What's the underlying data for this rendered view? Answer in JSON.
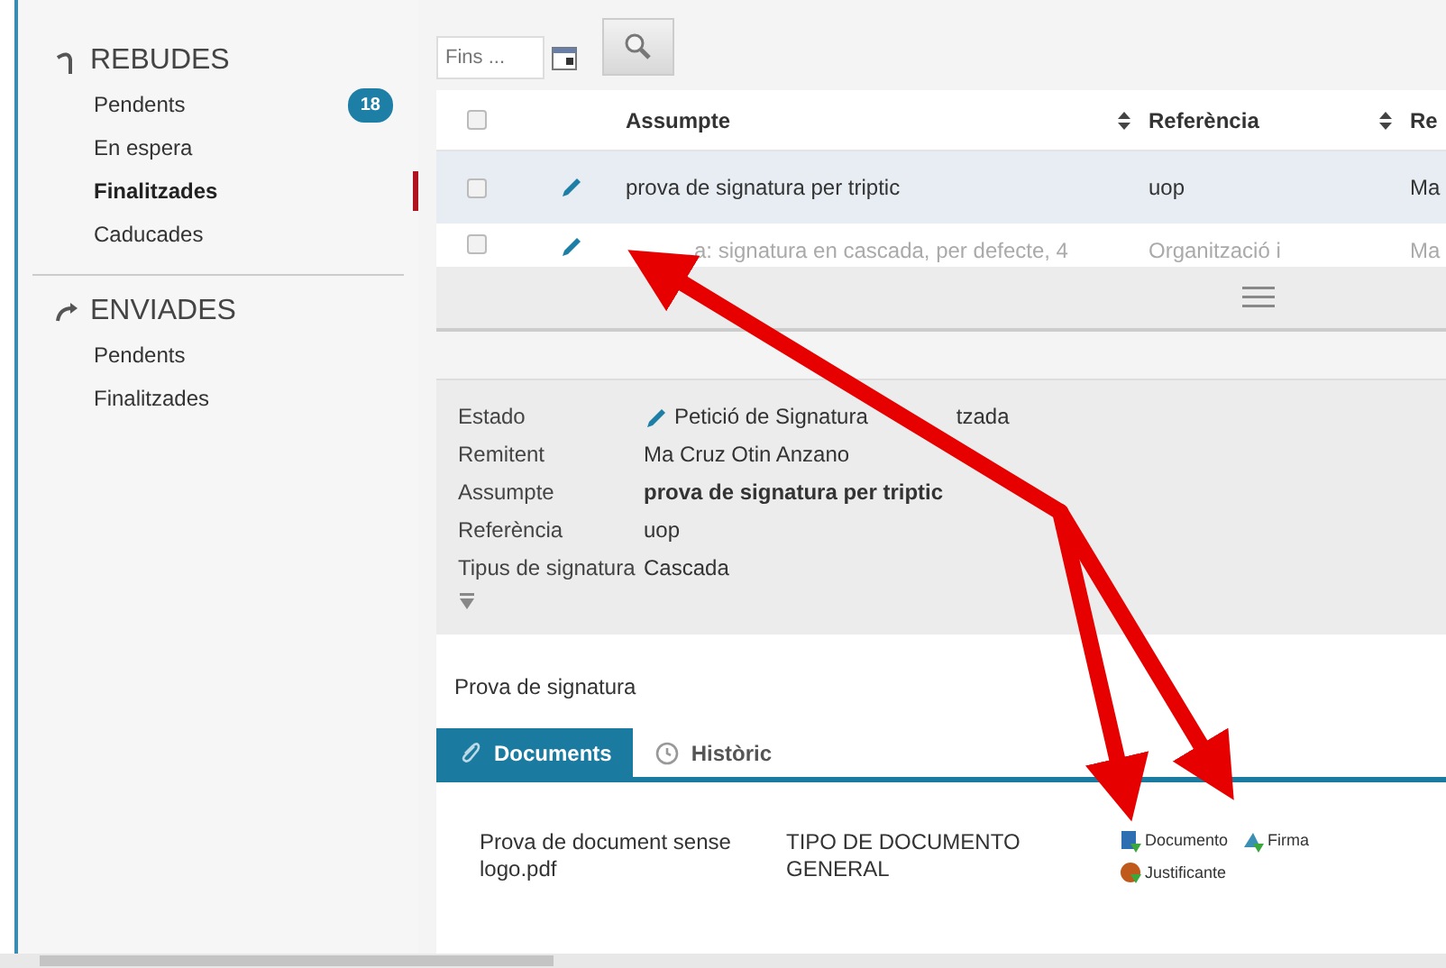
{
  "sidebar": {
    "sections": [
      {
        "title": "REBUDES",
        "items": [
          {
            "label": "Pendents",
            "badge": "18",
            "selected": false
          },
          {
            "label": "En espera",
            "selected": false
          },
          {
            "label": "Finalitzades",
            "selected": true
          },
          {
            "label": "Caducades",
            "selected": false
          }
        ]
      },
      {
        "title": "ENVIADES",
        "items": [
          {
            "label": "Pendents",
            "selected": false
          },
          {
            "label": "Finalitzades",
            "selected": false
          }
        ]
      }
    ]
  },
  "filter": {
    "placeholder": "Fins ..."
  },
  "table": {
    "select_all_checked": false,
    "columns": [
      {
        "label": "Assumpte",
        "sortable": true
      },
      {
        "label": "Referència",
        "sortable": true
      },
      {
        "label": "Re"
      }
    ],
    "rows": [
      {
        "checked": false,
        "selected": true,
        "faded": false,
        "cells": [
          "prova de signatura per triptic",
          "uop",
          "Ma"
        ]
      },
      {
        "checked": false,
        "selected": false,
        "faded": true,
        "cells": [
          "a: signatura en cascada, per defecte, 4",
          "Organització i",
          "Ma"
        ]
      }
    ]
  },
  "details": {
    "fields": [
      {
        "label": "Estado",
        "value": "Petició de Signatura",
        "value_rest": "tzada",
        "kind": "status",
        "bold": false
      },
      {
        "label": "Remitent",
        "value": "Ma Cruz Otin Anzano",
        "kind": "text",
        "bold": false
      },
      {
        "label": "Assumpte",
        "value": "prova de signatura per triptic",
        "kind": "text",
        "bold": true
      },
      {
        "label": "Referència",
        "value": "uop",
        "kind": "text",
        "bold": false
      },
      {
        "label": "Tipus de signatura",
        "value": "Cascada",
        "kind": "text",
        "bold": false
      }
    ]
  },
  "description": "Prova de signatura",
  "tabs": [
    {
      "label": "Documents",
      "selected": true
    },
    {
      "label": "Històric",
      "selected": false
    }
  ],
  "documents": [
    {
      "name": "Prova de document sense logo.pdf",
      "type": "TIPO DE DOCUMENTO GENERAL",
      "actions": [
        {
          "label": "Documento"
        },
        {
          "label": "Firma"
        },
        {
          "label": "Justificante"
        }
      ]
    }
  ]
}
